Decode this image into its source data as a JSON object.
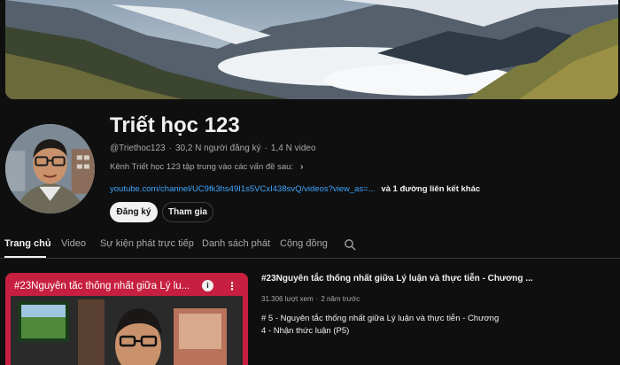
{
  "channel": {
    "name": "Triết học 123",
    "handle": "@Triethoc123",
    "subscribers": "30,2 N người đăng ký",
    "videos": "1,4 N video",
    "description": "Kênh Triết học 123 tập trung vào các vấn đề sau:",
    "link_url": "youtube.com/channel/UC9fk3hs49I1s5VCxI438svQ/videos?view_as=...",
    "link_more": "và 1 đường liên kết khác",
    "subscribe_label": "Đăng ký",
    "join_label": "Tham gia"
  },
  "tabs": [
    {
      "label": "Trang chủ",
      "active": true
    },
    {
      "label": "Video",
      "active": false
    },
    {
      "label": "Sự kiện phát trực tiếp",
      "active": false
    },
    {
      "label": "Danh sách phát",
      "active": false
    },
    {
      "label": "Cộng đồng",
      "active": false
    }
  ],
  "featured_video": {
    "thumb_title": "#23Nguyên tắc thống nhất giữa Lý lu...",
    "title": "#23Nguyên tắc thống nhất giữa Lý luận và thực tiễn - Chương ...",
    "views": "31.306 lượt xem",
    "age": "2 năm trước",
    "description": "# 5 - Nguyên tắc thống nhất giữa Lý luận và thực tiễn - Chương 4 - Nhận thức luận (P5)"
  },
  "icons": {
    "chevron": "chevron-right-icon",
    "search": "search-icon",
    "info": "info-icon",
    "kebab": "more-vert-icon"
  },
  "colors": {
    "background": "#0f0f0f",
    "link": "#3ea6ff",
    "thumb_accent": "#c71f3f"
  }
}
